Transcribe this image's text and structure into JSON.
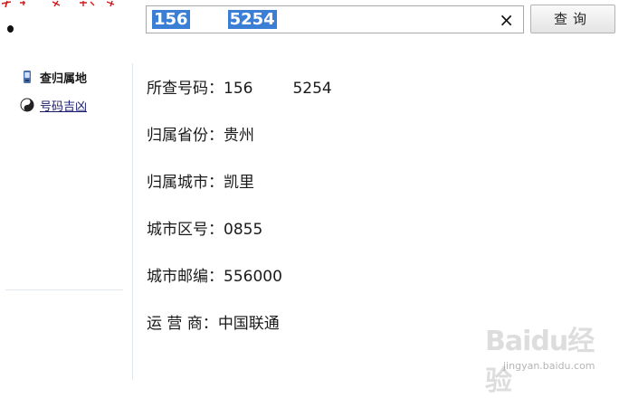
{
  "search": {
    "part1": "156",
    "part2": "5254",
    "clear_icon": "×",
    "button_label": "查询"
  },
  "sidebar": {
    "items": [
      {
        "label": "查归属地",
        "icon": "phone-icon",
        "active": true
      },
      {
        "label": "号码吉凶",
        "icon": "yin-yang-icon",
        "active": false
      }
    ]
  },
  "result": {
    "number": {
      "label": "所查号码：",
      "value_part1": "156",
      "value_part2": "5254"
    },
    "province": {
      "label": "归属省份：",
      "value": "贵州"
    },
    "city": {
      "label": "归属城市：",
      "value": "凯里"
    },
    "area_code": {
      "label": "城市区号：",
      "value": "0855"
    },
    "postcode": {
      "label": "城市邮编：",
      "value": "556000"
    },
    "carrier": {
      "label": "运 营 商：",
      "value": "中国联通"
    }
  },
  "watermark": {
    "text": "Baidu经验",
    "url": "jingyan.baidu.com"
  },
  "colors": {
    "selection": "#3a7fd5",
    "divider": "#e3e7ee",
    "link": "#1a1a6e"
  }
}
